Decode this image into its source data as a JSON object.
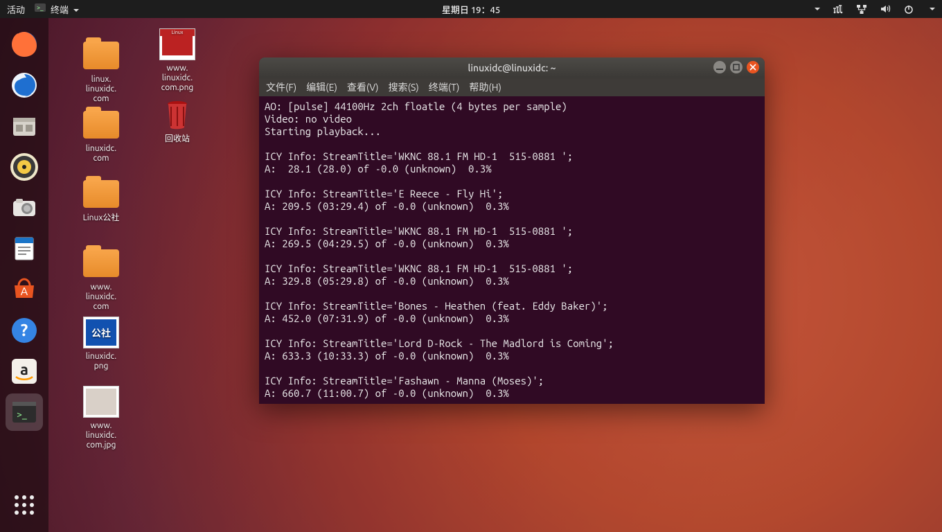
{
  "topbar": {
    "activities": "活动",
    "app_menu": "终端",
    "clock": "星期日 19：45"
  },
  "dock": {
    "items": [
      {
        "name": "firefox",
        "color": "#ff7139"
      },
      {
        "name": "thunderbird",
        "color": "#1f6fd0"
      },
      {
        "name": "files",
        "color": "#d7d3cb"
      },
      {
        "name": "rhythmbox",
        "color": "#efe7c9"
      },
      {
        "name": "shotwell",
        "color": "#e7e5e2"
      },
      {
        "name": "libreoffice-writer",
        "color": "#1a74c7"
      },
      {
        "name": "ubuntu-software",
        "color": "#e95420"
      },
      {
        "name": "help",
        "color": "#3584e4"
      },
      {
        "name": "amazon",
        "color": "#f4f0ea"
      },
      {
        "name": "terminal",
        "color": "#2c2c2c",
        "active": true
      }
    ]
  },
  "desktop": {
    "col1": [
      {
        "label": "linux.\nlinuxidc.\ncom",
        "type": "folder"
      },
      {
        "label": "linuxidc.\ncom",
        "type": "folder"
      },
      {
        "label": "Linux公社",
        "type": "folder"
      },
      {
        "label": "www.\nlinuxidc.\ncom",
        "type": "folder"
      },
      {
        "label": "linuxidc.\npng",
        "type": "image",
        "bg": "#1151b0",
        "badge": "公社"
      },
      {
        "label": "www.\nlinuxidc.\ncom.jpg",
        "type": "image",
        "bg": "#d9d0c8"
      }
    ],
    "col2": [
      {
        "label": "www.\nlinuxidc.\ncom.png",
        "type": "image",
        "bg": "#bb2222",
        "topband": true
      },
      {
        "label": "回收站",
        "type": "trash"
      }
    ]
  },
  "terminal": {
    "title": "linuxidc@linuxidc: ~",
    "menus": [
      "文件(F)",
      "编辑(E)",
      "查看(V)",
      "搜索(S)",
      "终端(T)",
      "帮助(H)"
    ],
    "lines": [
      "AO: [pulse] 44100Hz 2ch floatle (4 bytes per sample)",
      "Video: no video",
      "Starting playback...",
      "",
      "ICY Info: StreamTitle='WKNC 88.1 FM HD-1  515-0881 ';",
      "A:  28.1 (28.0) of -0.0 (unknown)  0.3%",
      "",
      "ICY Info: StreamTitle='E Reece - Fly Hi';",
      "A: 209.5 (03:29.4) of -0.0 (unknown)  0.3%",
      "",
      "ICY Info: StreamTitle='WKNC 88.1 FM HD-1  515-0881 ';",
      "A: 269.5 (04:29.5) of -0.0 (unknown)  0.3%",
      "",
      "ICY Info: StreamTitle='WKNC 88.1 FM HD-1  515-0881 ';",
      "A: 329.8 (05:29.8) of -0.0 (unknown)  0.3%",
      "",
      "ICY Info: StreamTitle='Bones - Heathen (feat. Eddy Baker)';",
      "A: 452.0 (07:31.9) of -0.0 (unknown)  0.3%",
      "",
      "ICY Info: StreamTitle='Lord D-Rock - The Madlord is Coming';",
      "A: 633.3 (10:33.3) of -0.0 (unknown)  0.3%",
      "",
      "ICY Info: StreamTitle='Fashawn - Manna (Moses)';",
      "A: 660.7 (11:00.7) of -0.0 (unknown)  0.3%"
    ]
  }
}
